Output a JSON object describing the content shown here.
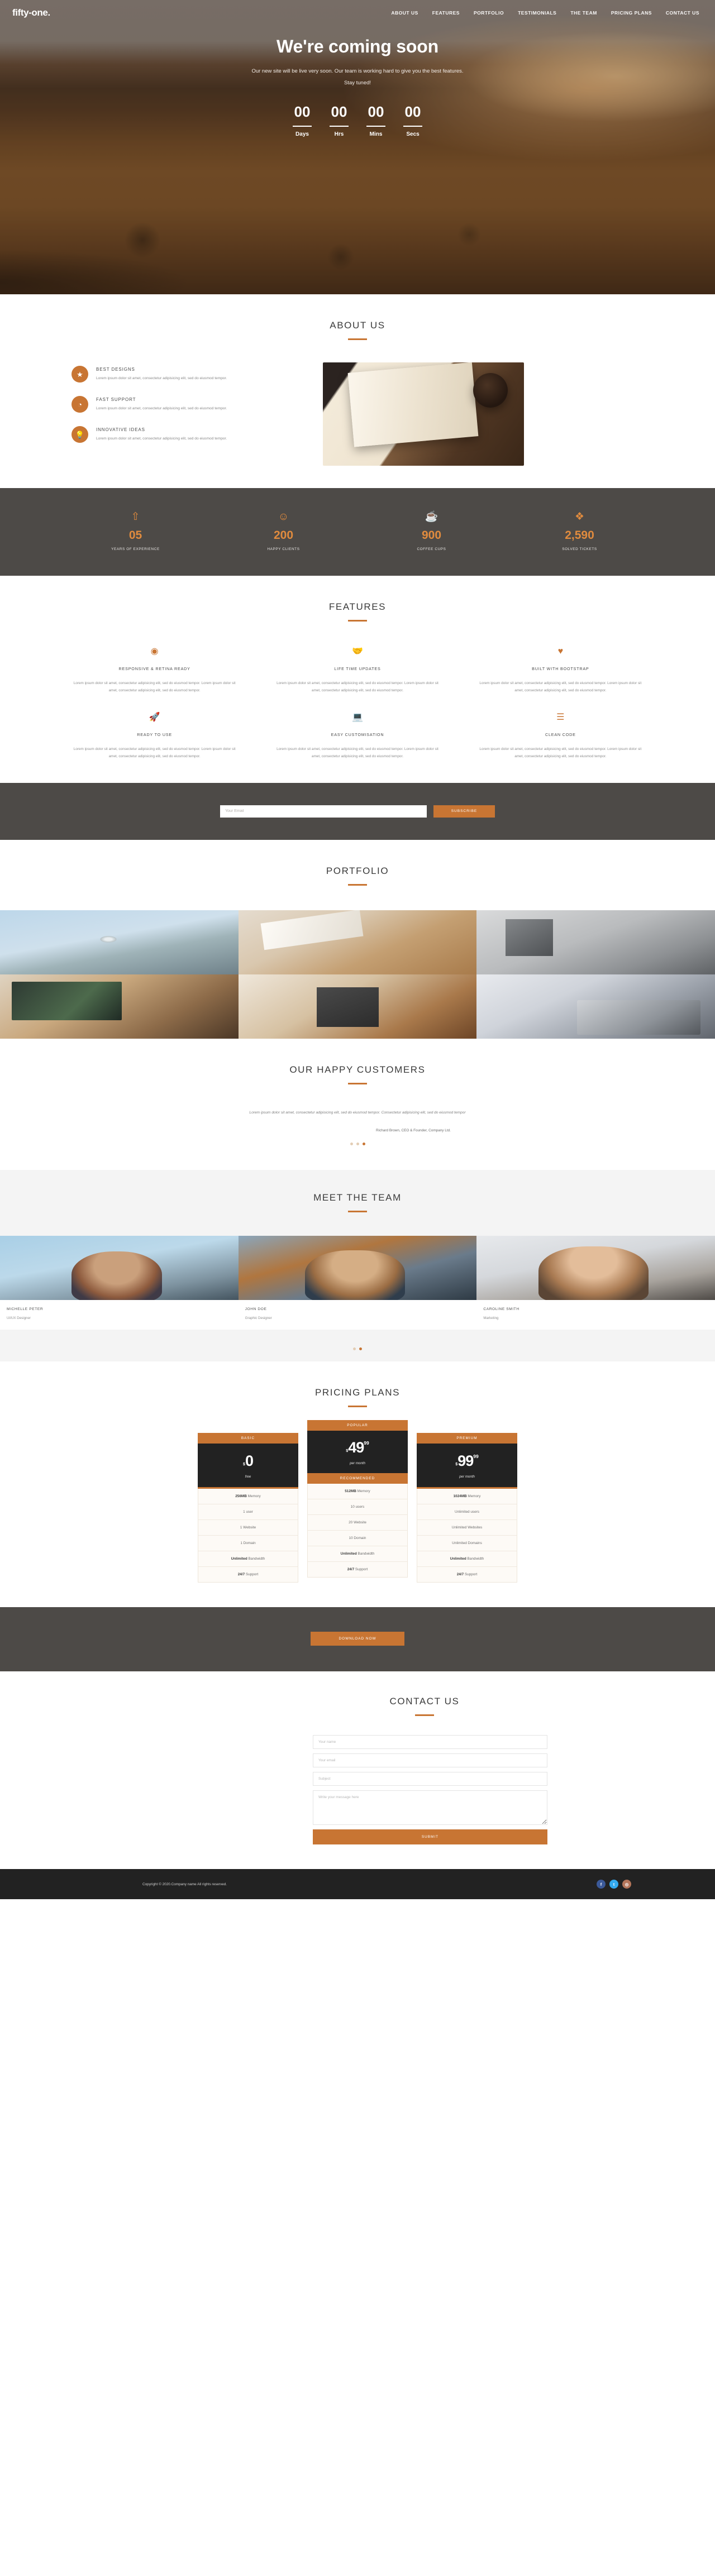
{
  "brand": {
    "logo": "fifty-one."
  },
  "nav": {
    "items": [
      {
        "label": "ABOUT US"
      },
      {
        "label": "FEATURES"
      },
      {
        "label": "PORTFOLIO"
      },
      {
        "label": "TESTIMONIALS"
      },
      {
        "label": "THE TEAM"
      },
      {
        "label": "PRICING PLANS"
      },
      {
        "label": "CONTACT US"
      }
    ]
  },
  "hero": {
    "title": "We're coming soon",
    "subtitle_line1": "Our new site will be live very soon. Our team is working hard to give you the best features.",
    "subtitle_line2": "Stay tuned!",
    "countdown": [
      {
        "value": "00",
        "label": "Days"
      },
      {
        "value": "00",
        "label": "Hrs"
      },
      {
        "value": "00",
        "label": "Mins"
      },
      {
        "value": "00",
        "label": "Secs"
      }
    ]
  },
  "about": {
    "title": "ABOUT US",
    "items": [
      {
        "icon": "star-icon",
        "glyph": "★",
        "title": "BEST DESIGNS",
        "text": "Lorem ipsum dolor sit amet, consectetur adipisicing elit, sed do eiusmod tempor."
      },
      {
        "icon": "clock-icon",
        "glyph": "◔",
        "title": "FAST SUPPORT",
        "text": "Lorem ipsum dolor sit amet, consectetur adipisicing elit, sed do eiusmod tempor."
      },
      {
        "icon": "lightbulb-icon",
        "glyph": "💡",
        "title": "INNOVATIVE IDEAS",
        "text": "Lorem ipsum dolor sit amet, consectetur adipisicing elit, sed do eiusmod tempor."
      }
    ]
  },
  "counters": {
    "items": [
      {
        "icon": "arrow-up-icon",
        "glyph": "⇧",
        "value": "05",
        "label": "YEARS OF EXPERIENCE"
      },
      {
        "icon": "smiley-icon",
        "glyph": "☺",
        "value": "200",
        "label": "HAPPY CLIENTS"
      },
      {
        "icon": "coffee-cup-icon",
        "glyph": "☕",
        "value": "900",
        "label": "COFFEE CUPS"
      },
      {
        "icon": "boxes-icon",
        "glyph": "❖",
        "value": "2,590",
        "label": "SOLVED TICKETS"
      }
    ]
  },
  "features": {
    "title": "FEATURES",
    "items": [
      {
        "icon": "eye-icon",
        "glyph": "◉",
        "title": "RESPONSIVE & RETINA READY",
        "text": "Lorem ipsum dolor sit amet, consectetur adipisicing elit, sed do eiusmod tempor. Lorem ipsum dolor sit amet, consectetur adipisicing elit, sed do eiusmod tempor."
      },
      {
        "icon": "handshake-icon",
        "glyph": "🤝",
        "title": "LIFE TIME UPDATES",
        "text": "Lorem ipsum dolor sit amet, consectetur adipisicing elit, sed do eiusmod tempor. Lorem ipsum dolor sit amet, consectetur adipisicing elit, sed do eiusmod tempor."
      },
      {
        "icon": "heart-icon",
        "glyph": "♥",
        "title": "BUILT WITH BOOTSTRAP",
        "text": "Lorem ipsum dolor sit amet, consectetur adipisicing elit, sed do eiusmod tempor. Lorem ipsum dolor sit amet, consectetur adipisicing elit, sed do eiusmod tempor."
      },
      {
        "icon": "rocket-icon",
        "glyph": "🚀",
        "title": "READY TO USE",
        "text": "Lorem ipsum dolor sit amet, consectetur adipisicing elit, sed do eiusmod tempor. Lorem ipsum dolor sit amet, consectetur adipisicing elit, sed do eiusmod tempor."
      },
      {
        "icon": "laptop-icon",
        "glyph": "💻",
        "title": "EASY CUSTOMISATION",
        "text": "Lorem ipsum dolor sit amet, consectetur adipisicing elit, sed do eiusmod tempor. Lorem ipsum dolor sit amet, consectetur adipisicing elit, sed do eiusmod tempor."
      },
      {
        "icon": "code-lines-icon",
        "glyph": "☰",
        "title": "CLEAN CODE",
        "text": "Lorem ipsum dolor sit amet, consectetur adipisicing elit, sed do eiusmod tempor. Lorem ipsum dolor sit amet, consectetur adipisicing elit, sed do eiusmod tempor."
      }
    ]
  },
  "subscribe": {
    "placeholder": "Your Email",
    "value": "",
    "button": "SUBSCRIBE"
  },
  "portfolio": {
    "title": "PORTFOLIO",
    "items": [
      {
        "alt": "drone-flying-over-mountains"
      },
      {
        "alt": "desk-with-laptop-notebooks-and-pencils"
      },
      {
        "alt": "grayscale-flatlay-of-gadgets-and-books"
      },
      {
        "alt": "imac-on-wooden-desk-with-keyboard"
      },
      {
        "alt": "explore-book-camera-and-phone-on-map"
      },
      {
        "alt": "fujifilm-camera-in-front-of-movie-poster"
      }
    ]
  },
  "testimonials": {
    "title": "OUR HAPPY CUSTOMERS",
    "quote": "Lorem ipsum dolor sit amet, consectetur adipisicing elit, sed do eiusmod tempor. Consectetur adipisicing elit, sed do eiusmod tempor",
    "author": "Richard Brown, CEO & Founder, Company Ltd.",
    "active_dot": 3,
    "dot_count": 3
  },
  "team": {
    "title": "MEET THE TEAM",
    "members": [
      {
        "name": "MICHELLE PETER",
        "role": "UI/UX Designer",
        "alt": "portrait-of-woman-with-red-hair"
      },
      {
        "name": "JOHN DOE",
        "role": "Graphic Designer",
        "alt": "portrait-of-man-with-sunglasses-laughing"
      },
      {
        "name": "CAROLINE SMITH",
        "role": "Marketing",
        "alt": "portrait-of-woman-in-turtleneck"
      }
    ],
    "active_dot": 2,
    "dot_count": 2
  },
  "pricing": {
    "title": "PRICING PLANS",
    "plans": [
      {
        "ribbon_top": "BASIC",
        "currency": "$",
        "amount": "0",
        "cents": "",
        "period": "free",
        "ribbon_bottom": "",
        "features": [
          "256MB Memory",
          "1 user",
          "1 Website",
          "1 Domain",
          "Unlimited Bandwidth",
          "24/7 Support"
        ],
        "features_bold": [
          "256MB",
          "",
          "",
          "",
          "Unlimited",
          "24/7"
        ]
      },
      {
        "ribbon_top": "POPULAR",
        "currency": "$",
        "amount": "49",
        "cents": "99",
        "period": "per month",
        "ribbon_bottom": "RECOMMENDED",
        "features": [
          "512MB Memory",
          "10 users",
          "20 Website",
          "10 Domain",
          "Unlimited Bandwidth",
          "24/7 Support"
        ],
        "features_bold": [
          "512MB",
          "",
          "",
          "",
          "Unlimited",
          "24/7"
        ]
      },
      {
        "ribbon_top": "PREMIUM",
        "currency": "$",
        "amount": "99",
        "cents": "99",
        "period": "per month",
        "ribbon_bottom": "",
        "features": [
          "1024MB Memory",
          "Unlimited users",
          "Unlimited Websites",
          "Unlimited Domains",
          "Unlimited Bandwidth",
          "24/7 Support"
        ],
        "features_bold": [
          "1024MB",
          "",
          "",
          "",
          "Unlimited",
          "24/7"
        ]
      }
    ]
  },
  "download": {
    "button": "DOWNLOAD NOW"
  },
  "contact": {
    "title": "CONTACT US",
    "name_placeholder": "Your name",
    "email_placeholder": "Your email",
    "subject_placeholder": "Subject",
    "message_placeholder": "Write your message here",
    "name_value": "",
    "email_value": "",
    "subject_value": "",
    "message_value": "",
    "submit": "SUBMIT"
  },
  "footer": {
    "copyright": "Copyright © 2020.Company name All rights reserved.",
    "socials": [
      {
        "name": "facebook-icon",
        "glyph": "f",
        "color": "#3b5998"
      },
      {
        "name": "twitter-icon",
        "glyph": "t",
        "color": "#33aaf0"
      },
      {
        "name": "instagram-icon",
        "glyph": "◎",
        "color": "#b4755a"
      }
    ]
  },
  "theme": {
    "accent": "#c87533",
    "dark": "#222222",
    "gray": "#4d4a47"
  }
}
